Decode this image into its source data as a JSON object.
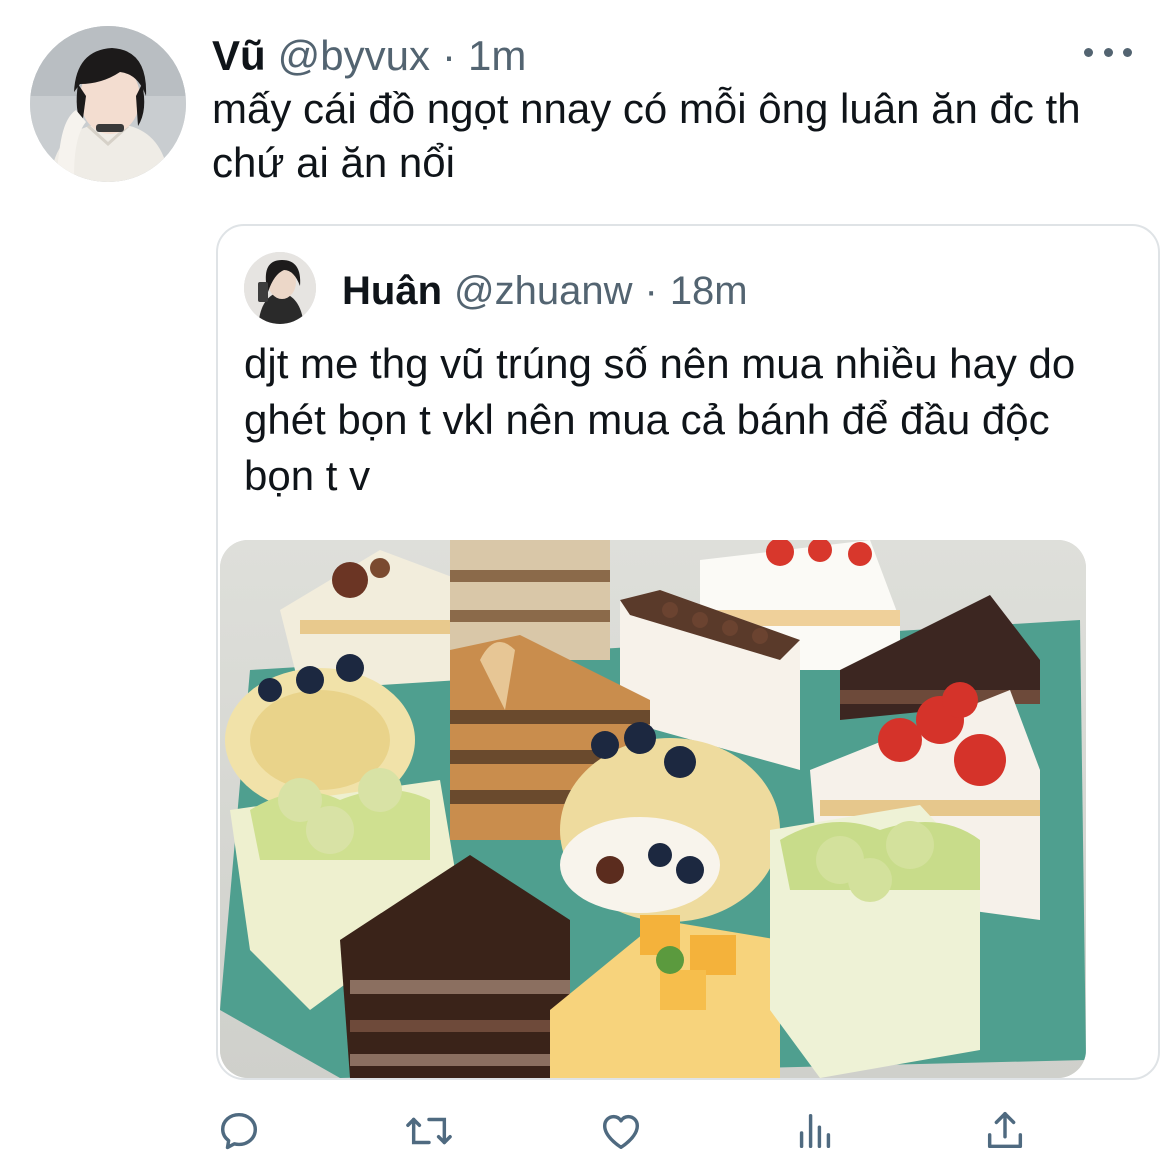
{
  "tweet": {
    "author_name": "Vũ",
    "author_handle": "@byvux",
    "separator": "·",
    "time": "1m",
    "text": "mấy cái đồ ngọt nnay có mỗi ông luân ăn đc th chứ ai ăn nổi"
  },
  "quoted_tweet": {
    "author_name": "Huân",
    "author_handle": "@zhuanw",
    "separator": "·",
    "time": "18m",
    "text": "djt me thg vũ trúng số nên mua nhiều hay do ghét bọn t vkl nên mua cả bánh để đầu độc bọn t v"
  },
  "icons": {
    "more": "more-horizontal-icon",
    "reply": "reply-icon",
    "retweet": "retweet-icon",
    "like": "heart-icon",
    "analytics": "analytics-icon",
    "share": "share-icon"
  },
  "colors": {
    "text": "#0f1419",
    "secondary": "#536471",
    "border": "#dfe3e6",
    "icon": "#4f6a80"
  }
}
